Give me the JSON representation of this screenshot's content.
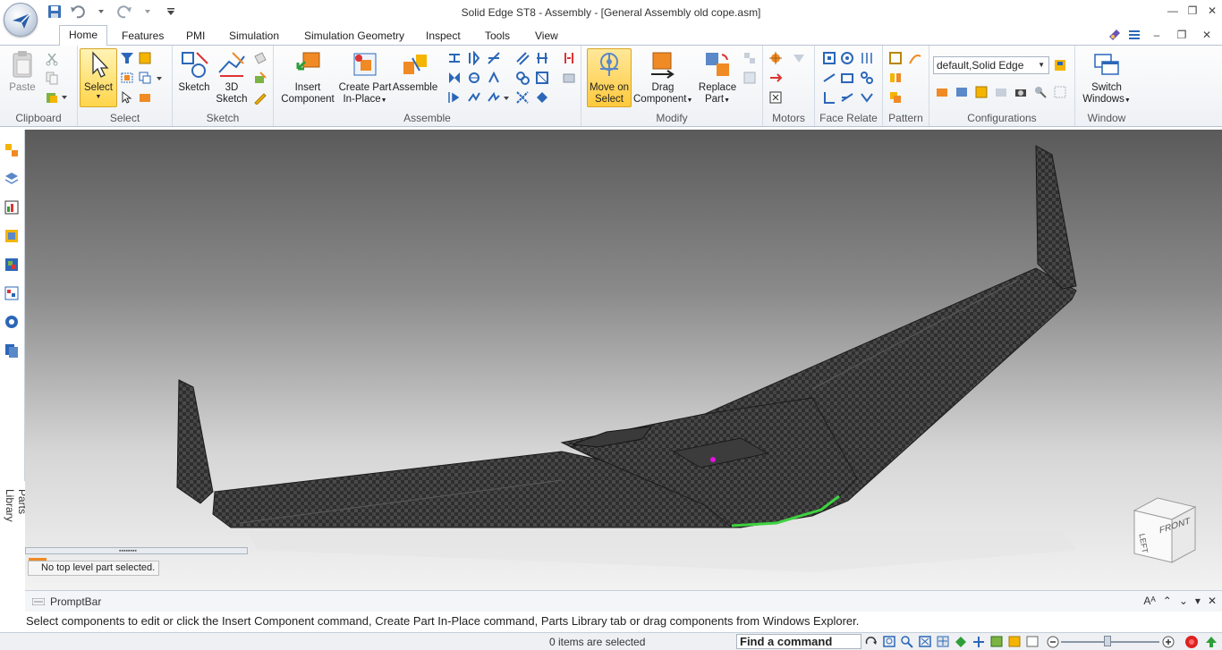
{
  "window": {
    "title": "Solid Edge ST8 - Assembly - [General Assembly old cope.asm]",
    "controls": [
      "—",
      "❐",
      "✕"
    ]
  },
  "quick_access": {
    "icons": [
      "save-icon",
      "undo-icon",
      "redo-icon",
      "customize-icon"
    ]
  },
  "tabs": [
    {
      "label": "Home",
      "active": true
    },
    {
      "label": "Features"
    },
    {
      "label": "PMI"
    },
    {
      "label": "Simulation"
    },
    {
      "label": "Simulation Geometry"
    },
    {
      "label": "Inspect"
    },
    {
      "label": "Tools"
    },
    {
      "label": "View"
    }
  ],
  "ribbon": {
    "clipboard": {
      "label": "Clipboard",
      "paste": "Paste"
    },
    "select": {
      "label": "Select",
      "select": "Select"
    },
    "sketch": {
      "label": "Sketch",
      "sketch": "Sketch",
      "sketch3d_line1": "3D",
      "sketch3d_line2": "Sketch"
    },
    "assemble": {
      "label": "Assemble",
      "insert_line1": "Insert",
      "insert_line2": "Component",
      "create_line1": "Create Part",
      "create_line2": "In-Place",
      "assemble": "Assemble"
    },
    "modify": {
      "label": "Modify",
      "move_line1": "Move on",
      "move_line2": "Select",
      "drag_line1": "Drag",
      "drag_line2": "Component",
      "replace_line1": "Replace",
      "replace_line2": "Part"
    },
    "motors": {
      "label": "Motors"
    },
    "face_relate": {
      "label": "Face Relate"
    },
    "pattern": {
      "label": "Pattern"
    },
    "configurations": {
      "label": "Configurations",
      "value": "default,Solid Edge"
    },
    "window": {
      "label": "Window",
      "switch_line1": "Switch",
      "switch_line2": "Windows"
    }
  },
  "sidebar": {
    "label": "Parts Library",
    "icons": [
      "assembly-pathfinder-icon",
      "layers-icon",
      "sensors-icon",
      "select-tools-icon",
      "features-library-icon",
      "reports-icon",
      "config-icon",
      "parts-library-icon"
    ]
  },
  "viewport": {
    "view_cube": {
      "face_front": "FRONT",
      "face_left": "LEFT"
    },
    "status_tip": "No top level part selected."
  },
  "promptbar": {
    "title": "PromptBar",
    "message": "Select components to edit or click the Insert Component command, Create Part In-Place command, Parts Library tab or drag components from Windows Explorer."
  },
  "statusbar": {
    "items_selected": "0 items are selected",
    "find_command": "Find a command"
  }
}
